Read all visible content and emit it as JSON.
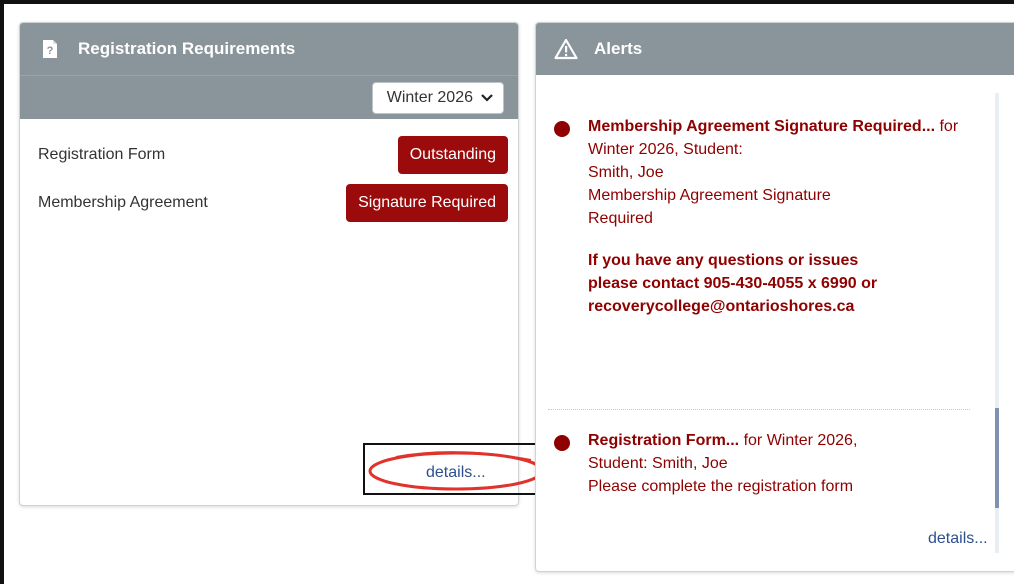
{
  "registration": {
    "title": "Registration Requirements",
    "icon": "document-question-icon",
    "term": "Winter 2026",
    "items": [
      {
        "label": "Registration Form",
        "status": "Outstanding"
      },
      {
        "label": "Membership Agreement",
        "status": "Signature Required"
      }
    ],
    "details_label": "details..."
  },
  "alerts": {
    "title": "Alerts",
    "icon": "warning-triangle-icon",
    "items": [
      {
        "title": "Membership Agreement Signature Required...",
        "line1_suffix": " for Winter 2026, Student:",
        "line2": "Smith, Joe",
        "message1": "Membership Agreement Signature",
        "message2": "Required",
        "contact1": "If you have any questions or issues",
        "contact2": "please contact  905-430-4055 x 6990 or",
        "contact3": "recoverycollege@ontarioshores.ca"
      },
      {
        "title": "Registration Form...",
        "line1_suffix": " for Winter 2026,",
        "line2": "Student: Smith, Joe",
        "message1": "Please complete the registration form"
      }
    ],
    "details_label": "details..."
  },
  "colors": {
    "header_bg": "#8a949b",
    "badge_bg": "#9b0b0b",
    "alert_text": "#8f0000",
    "link": "#2d4f8f",
    "annotation_red": "#e0332c"
  }
}
